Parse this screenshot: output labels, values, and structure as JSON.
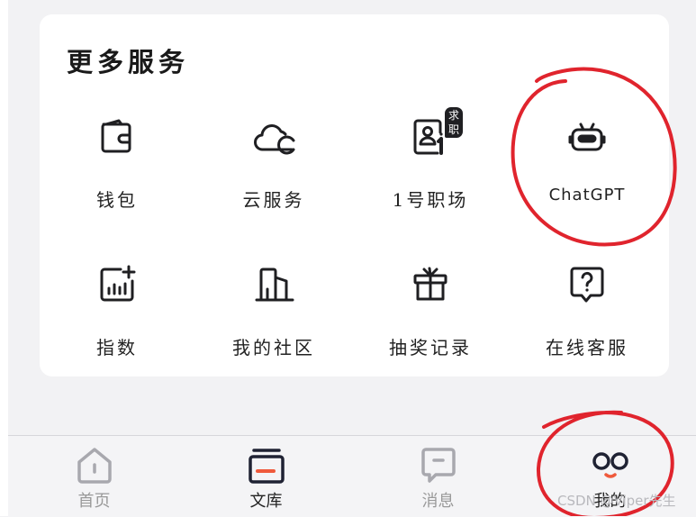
{
  "section": {
    "title": "更多服务"
  },
  "services": [
    {
      "label": "钱包",
      "icon": "wallet-icon"
    },
    {
      "label": "云服务",
      "icon": "cloud-icon"
    },
    {
      "label": "1号职场",
      "icon": "id-card-icon",
      "badge": "求职"
    },
    {
      "label": "ChatGPT",
      "icon": "robot-icon"
    },
    {
      "label": "指数",
      "icon": "chart-plus-icon"
    },
    {
      "label": "我的社区",
      "icon": "buildings-icon"
    },
    {
      "label": "抽奖记录",
      "icon": "gift-icon"
    },
    {
      "label": "在线客服",
      "icon": "help-bubble-icon"
    }
  ],
  "tabs": [
    {
      "label": "首页",
      "icon": "home-icon",
      "active": false
    },
    {
      "label": "文库",
      "icon": "library-icon",
      "active": true
    },
    {
      "label": "消息",
      "icon": "message-icon",
      "active": false
    },
    {
      "label": "我的",
      "icon": "profile-face-icon",
      "active": false
    }
  ],
  "watermark": "CSDN @Viper先生",
  "colors": {
    "accent": "#ef5a3c",
    "annotation_red": "#e0242d",
    "inactive_icon": "#a8a8ae",
    "text_dark": "#222222"
  }
}
